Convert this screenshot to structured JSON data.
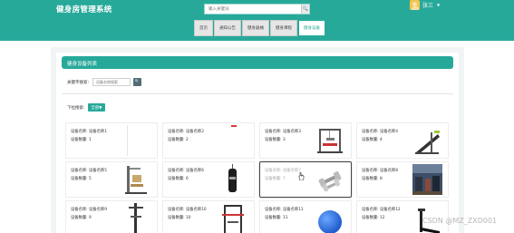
{
  "header": {
    "site_title": "健身房管理系统",
    "search_placeholder": "输入关键词",
    "search_button": "🔍",
    "user_name": "张三",
    "user_caret": "▼"
  },
  "nav": {
    "items": [
      {
        "label": "首页",
        "active": false
      },
      {
        "label": "通知公告",
        "active": false
      },
      {
        "label": "健身器械",
        "active": false
      },
      {
        "label": "健身课程",
        "active": false
      },
      {
        "label": "健身设备",
        "active": true
      }
    ]
  },
  "panel": {
    "title": "健身设备列表",
    "keyword_label": "关键字搜索:",
    "keyword_placeholder": "设备名称搜索",
    "keyword_button": "🔍",
    "filter_label": "下拉搜索:",
    "filter_value": "全部▼"
  },
  "cards": [
    {
      "name": "设备名称: 设备名称1",
      "qty": "设备数量: 1",
      "image": "empty-image"
    },
    {
      "name": "设备名称: 设备名称2",
      "qty": "设备数量: 2",
      "image": "red-mark"
    },
    {
      "name": "设备名称: 设备名称3",
      "qty": "设备数量: 3",
      "image": "multi-station-gym"
    },
    {
      "name": "设备名称: 设备名称4",
      "qty": "设备数量: 4",
      "image": "ab-bench"
    },
    {
      "name": "设备名称: 设备名称5",
      "qty": "设备数量: 5",
      "image": "weight-machine"
    },
    {
      "name": "设备名称: 设备名称6",
      "qty": "设备数量: 6",
      "image": "punching-bag"
    },
    {
      "name": "设备名称: 设备名称7",
      "qty": "设备数量: 7",
      "image": "dumbbells",
      "hover": true
    },
    {
      "name": "设备名称: 设备名称8",
      "qty": "设备数量: 8",
      "image": "gym-room-photo"
    },
    {
      "name": "设备名称: 设备名称9",
      "qty": "设备数量: 9",
      "image": "pull-up-tower"
    },
    {
      "name": "设备名称: 设备名称10",
      "qty": "设备数量: 10",
      "image": "power-rack"
    },
    {
      "name": "设备名称: 设备名称11",
      "qty": "设备数量: 11",
      "image": "blue-gym-ball"
    },
    {
      "name": "设备名称: 设备名称12",
      "qty": "设备数量: 12",
      "image": "treadmill"
    }
  ],
  "watermark": "CSDN @MZ_ZXD001",
  "colors": {
    "primary": "#27a99a",
    "search_button": "#546d73"
  }
}
